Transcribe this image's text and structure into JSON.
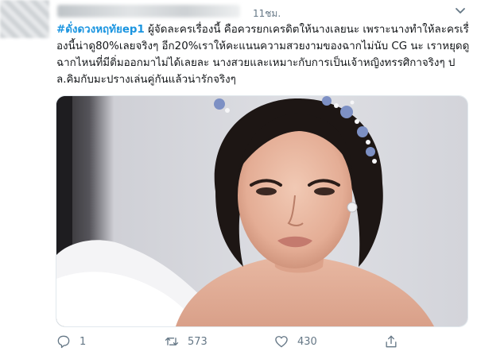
{
  "tweet": {
    "timestamp": "11ชม.",
    "hashtag": "#ดั่งดวงหฤทัยep1",
    "body": " ผู้จัดละครเรื่องนี้ คือควรยกเครดิตให้นางเลยนะ เพราะนางทำให้ละครเรื่องนี้น่าดู80%เลยจริงๆ อีก20%เราให้คะแนนความสวยงามของฉากไม่นับ CG นะ เราหยุดดูฉากไหนที่มีติ่มออกมาไม่ได้เลยละ นางสวยและเหมาะกับการเป็นเจ้าหญิงทรรศิกาจริงๆ ปล.คิมกับมะปรางเล่นคู่กันแล้วน่ารักจริงๆ"
  },
  "actions": {
    "reply_count": "1",
    "retweet_count": "573",
    "like_count": "430"
  },
  "colors": {
    "link": "#1b95e0",
    "icon": "#657786"
  },
  "icons": [
    "chevron-down-icon",
    "reply-icon",
    "retweet-icon",
    "like-icon",
    "share-icon"
  ]
}
